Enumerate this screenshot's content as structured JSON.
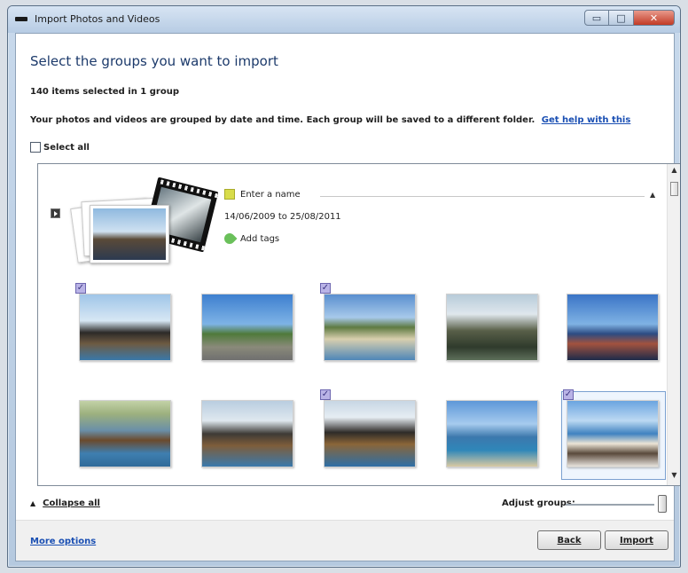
{
  "window": {
    "title": "Import Photos and Videos",
    "controls": {
      "minimize": "▭",
      "maximize": "□",
      "close": "✕"
    }
  },
  "header": {
    "heading": "Select the groups you want to import",
    "selection_count": "140 items selected in 1 group",
    "info_text": "Your photos and videos are grouped by date and time. Each group will be saved to a different folder.",
    "help_link": "Get help with this",
    "select_all_label": "Select all"
  },
  "group": {
    "name_placeholder": "Enter a name",
    "date_range": "14/06/2009 to 25/08/2011",
    "add_tags_label": "Add tags",
    "expand_icon": "play-triangle-icon",
    "collapse_icon": "chevron-up-icon"
  },
  "photos": [
    {
      "checked": true,
      "subject": "tall ship at harbour"
    },
    {
      "checked": false,
      "subject": "coastal town"
    },
    {
      "checked": true,
      "subject": "beach and headland"
    },
    {
      "checked": false,
      "subject": "cliff ruins"
    },
    {
      "checked": false,
      "subject": "people on boat"
    },
    {
      "checked": false,
      "subject": "galleon model on water"
    },
    {
      "checked": false,
      "subject": "galleon sailing"
    },
    {
      "checked": true,
      "subject": "galleon close-up"
    },
    {
      "checked": false,
      "subject": "sea with boat"
    },
    {
      "checked": true,
      "subject": "person at beach",
      "selected": true
    }
  ],
  "footer": {
    "collapse_all_label": "Collapse all",
    "adjust_groups_label": "Adjust groups:",
    "more_options_label": "More options",
    "back_label": "Back",
    "import_label": "Import"
  },
  "colors": {
    "heading": "#1c3a6b",
    "link": "#1a4fb3",
    "close_button": "#c23a25"
  }
}
